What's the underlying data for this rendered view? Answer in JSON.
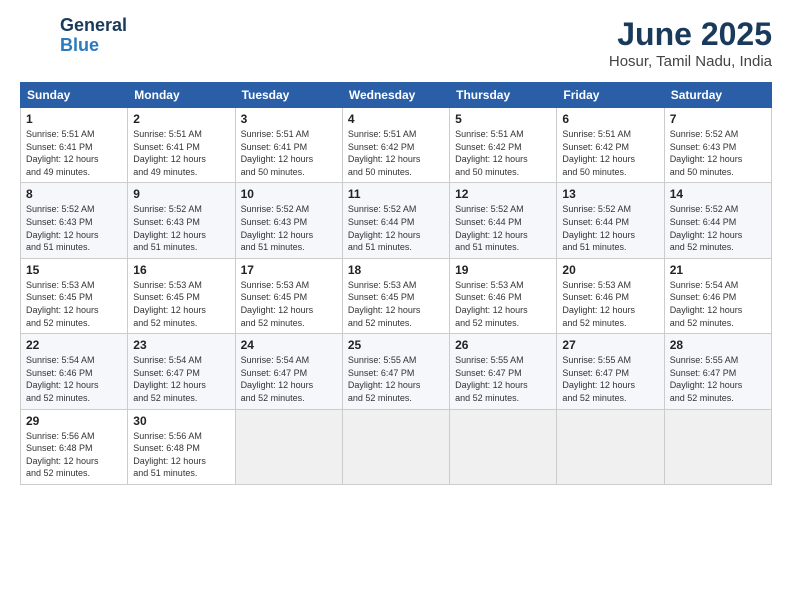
{
  "logo": {
    "line1": "General",
    "line2": "Blue"
  },
  "title": "June 2025",
  "subtitle": "Hosur, Tamil Nadu, India",
  "days_of_week": [
    "Sunday",
    "Monday",
    "Tuesday",
    "Wednesday",
    "Thursday",
    "Friday",
    "Saturday"
  ],
  "weeks": [
    [
      {
        "day": "1",
        "info": "Sunrise: 5:51 AM\nSunset: 6:41 PM\nDaylight: 12 hours\nand 49 minutes."
      },
      {
        "day": "2",
        "info": "Sunrise: 5:51 AM\nSunset: 6:41 PM\nDaylight: 12 hours\nand 49 minutes."
      },
      {
        "day": "3",
        "info": "Sunrise: 5:51 AM\nSunset: 6:41 PM\nDaylight: 12 hours\nand 50 minutes."
      },
      {
        "day": "4",
        "info": "Sunrise: 5:51 AM\nSunset: 6:42 PM\nDaylight: 12 hours\nand 50 minutes."
      },
      {
        "day": "5",
        "info": "Sunrise: 5:51 AM\nSunset: 6:42 PM\nDaylight: 12 hours\nand 50 minutes."
      },
      {
        "day": "6",
        "info": "Sunrise: 5:51 AM\nSunset: 6:42 PM\nDaylight: 12 hours\nand 50 minutes."
      },
      {
        "day": "7",
        "info": "Sunrise: 5:52 AM\nSunset: 6:43 PM\nDaylight: 12 hours\nand 50 minutes."
      }
    ],
    [
      {
        "day": "8",
        "info": "Sunrise: 5:52 AM\nSunset: 6:43 PM\nDaylight: 12 hours\nand 51 minutes."
      },
      {
        "day": "9",
        "info": "Sunrise: 5:52 AM\nSunset: 6:43 PM\nDaylight: 12 hours\nand 51 minutes."
      },
      {
        "day": "10",
        "info": "Sunrise: 5:52 AM\nSunset: 6:43 PM\nDaylight: 12 hours\nand 51 minutes."
      },
      {
        "day": "11",
        "info": "Sunrise: 5:52 AM\nSunset: 6:44 PM\nDaylight: 12 hours\nand 51 minutes."
      },
      {
        "day": "12",
        "info": "Sunrise: 5:52 AM\nSunset: 6:44 PM\nDaylight: 12 hours\nand 51 minutes."
      },
      {
        "day": "13",
        "info": "Sunrise: 5:52 AM\nSunset: 6:44 PM\nDaylight: 12 hours\nand 51 minutes."
      },
      {
        "day": "14",
        "info": "Sunrise: 5:52 AM\nSunset: 6:44 PM\nDaylight: 12 hours\nand 52 minutes."
      }
    ],
    [
      {
        "day": "15",
        "info": "Sunrise: 5:53 AM\nSunset: 6:45 PM\nDaylight: 12 hours\nand 52 minutes."
      },
      {
        "day": "16",
        "info": "Sunrise: 5:53 AM\nSunset: 6:45 PM\nDaylight: 12 hours\nand 52 minutes."
      },
      {
        "day": "17",
        "info": "Sunrise: 5:53 AM\nSunset: 6:45 PM\nDaylight: 12 hours\nand 52 minutes."
      },
      {
        "day": "18",
        "info": "Sunrise: 5:53 AM\nSunset: 6:45 PM\nDaylight: 12 hours\nand 52 minutes."
      },
      {
        "day": "19",
        "info": "Sunrise: 5:53 AM\nSunset: 6:46 PM\nDaylight: 12 hours\nand 52 minutes."
      },
      {
        "day": "20",
        "info": "Sunrise: 5:53 AM\nSunset: 6:46 PM\nDaylight: 12 hours\nand 52 minutes."
      },
      {
        "day": "21",
        "info": "Sunrise: 5:54 AM\nSunset: 6:46 PM\nDaylight: 12 hours\nand 52 minutes."
      }
    ],
    [
      {
        "day": "22",
        "info": "Sunrise: 5:54 AM\nSunset: 6:46 PM\nDaylight: 12 hours\nand 52 minutes."
      },
      {
        "day": "23",
        "info": "Sunrise: 5:54 AM\nSunset: 6:47 PM\nDaylight: 12 hours\nand 52 minutes."
      },
      {
        "day": "24",
        "info": "Sunrise: 5:54 AM\nSunset: 6:47 PM\nDaylight: 12 hours\nand 52 minutes."
      },
      {
        "day": "25",
        "info": "Sunrise: 5:55 AM\nSunset: 6:47 PM\nDaylight: 12 hours\nand 52 minutes."
      },
      {
        "day": "26",
        "info": "Sunrise: 5:55 AM\nSunset: 6:47 PM\nDaylight: 12 hours\nand 52 minutes."
      },
      {
        "day": "27",
        "info": "Sunrise: 5:55 AM\nSunset: 6:47 PM\nDaylight: 12 hours\nand 52 minutes."
      },
      {
        "day": "28",
        "info": "Sunrise: 5:55 AM\nSunset: 6:47 PM\nDaylight: 12 hours\nand 52 minutes."
      }
    ],
    [
      {
        "day": "29",
        "info": "Sunrise: 5:56 AM\nSunset: 6:48 PM\nDaylight: 12 hours\nand 52 minutes."
      },
      {
        "day": "30",
        "info": "Sunrise: 5:56 AM\nSunset: 6:48 PM\nDaylight: 12 hours\nand 51 minutes."
      },
      {
        "day": "",
        "info": ""
      },
      {
        "day": "",
        "info": ""
      },
      {
        "day": "",
        "info": ""
      },
      {
        "day": "",
        "info": ""
      },
      {
        "day": "",
        "info": ""
      }
    ]
  ]
}
